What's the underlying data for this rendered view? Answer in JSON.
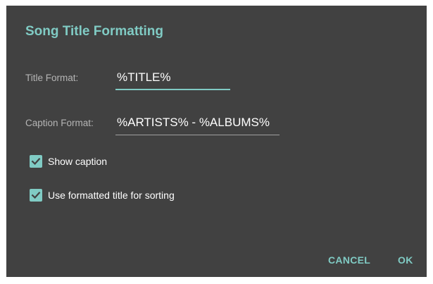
{
  "dialog": {
    "title": "Song Title Formatting",
    "title_format": {
      "label": "Title Format:",
      "value": "%TITLE%"
    },
    "caption_format": {
      "label": "Caption Format:",
      "value": "%ARTISTS% - %ALBUMS%"
    },
    "show_caption": {
      "label": "Show caption",
      "checked": true
    },
    "use_formatted_title": {
      "label": "Use formatted title for sorting",
      "checked": true
    },
    "buttons": {
      "cancel": "CANCEL",
      "ok": "OK"
    }
  },
  "colors": {
    "accent": "#80cbc4",
    "dialog_background": "#414141",
    "label_text": "#b5b5b5",
    "value_text": "#ffffff"
  },
  "icons": {
    "checkbox": "check-icon"
  }
}
